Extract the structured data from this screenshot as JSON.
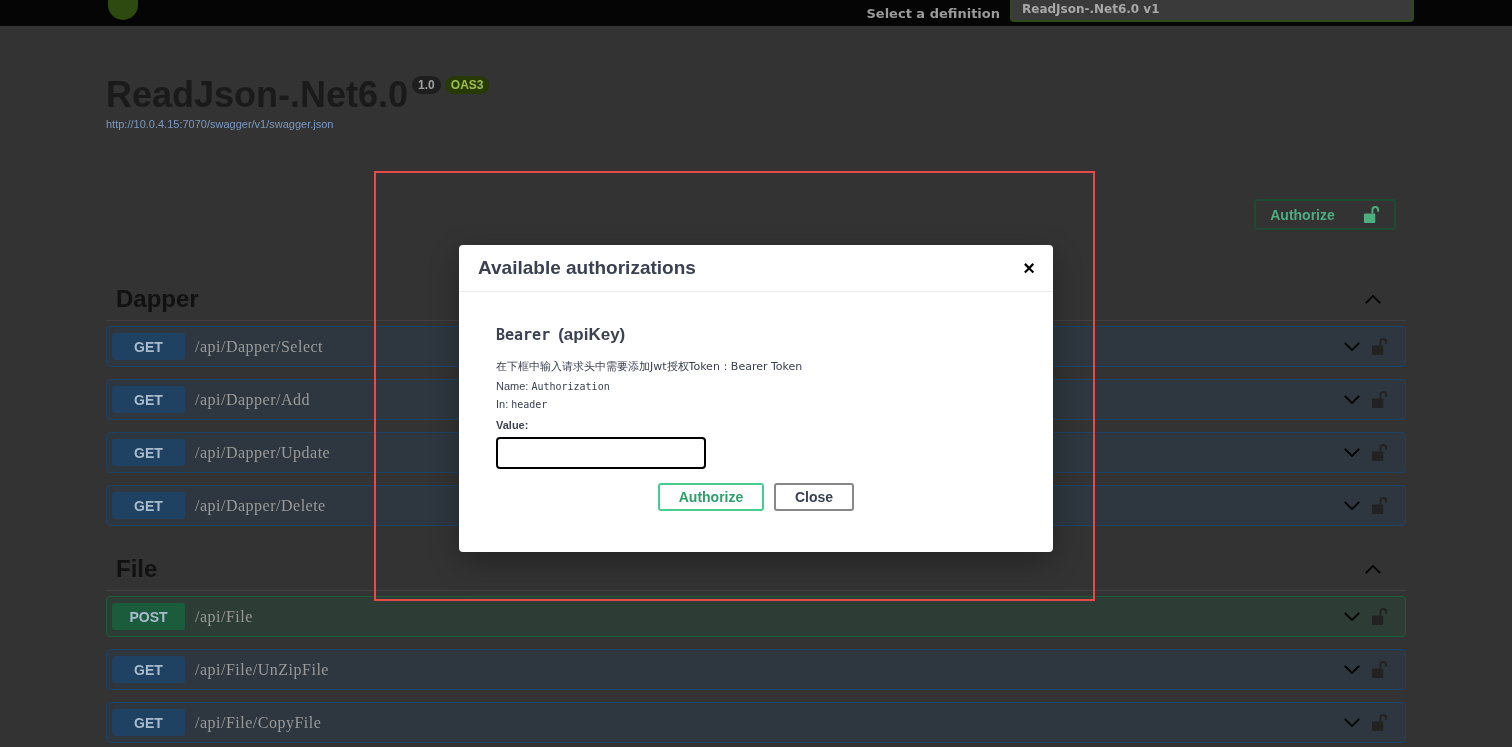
{
  "topbar": {
    "definition_label": "Select a definition",
    "definition_value": "ReadJson-.Net6.0 v1"
  },
  "info": {
    "title": "ReadJson-.Net6.0",
    "version": "1.0",
    "oas": "OAS3",
    "url": "http://10.0.4.15:7070/swagger/v1/swagger.json"
  },
  "authorize_button": {
    "label": "Authorize",
    "locked": false
  },
  "sections": [
    {
      "name": "Dapper",
      "expanded": true,
      "operations": [
        {
          "method": "GET",
          "color": "#1f4262",
          "path": "/api/Dapper/Select",
          "expanded": false,
          "locked": false
        },
        {
          "method": "GET",
          "color": "#1f4262",
          "path": "/api/Dapper/Add",
          "expanded": false,
          "locked": false
        },
        {
          "method": "GET",
          "color": "#1f4262",
          "path": "/api/Dapper/Update",
          "expanded": false,
          "locked": false
        },
        {
          "method": "GET",
          "color": "#1f4262",
          "path": "/api/Dapper/Delete",
          "expanded": false,
          "locked": false
        }
      ]
    },
    {
      "name": "File",
      "expanded": true,
      "operations": [
        {
          "method": "POST",
          "color": "#1b5c3d",
          "path": "/api/File",
          "expanded": false,
          "locked": false
        },
        {
          "method": "GET",
          "color": "#1f4262",
          "path": "/api/File/UnZipFile",
          "expanded": false,
          "locked": false
        },
        {
          "method": "GET",
          "color": "#1f4262",
          "path": "/api/File/CopyFile",
          "expanded": false,
          "locked": false
        }
      ]
    }
  ],
  "modal": {
    "title": "Available authorizations",
    "close": "×",
    "scheme_name": "Bearer",
    "scheme_type": "(apiKey)",
    "description": "在下框中输入请求头中需要添加Jwt授权Token：Bearer Token",
    "name_label": "Name:",
    "name_value": "Authorization",
    "in_label": "In:",
    "in_value": "header",
    "value_label": "Value:",
    "buttons": [
      {
        "label": "Authorize",
        "kind": "primary"
      },
      {
        "label": "Close",
        "kind": "secondary"
      }
    ]
  }
}
